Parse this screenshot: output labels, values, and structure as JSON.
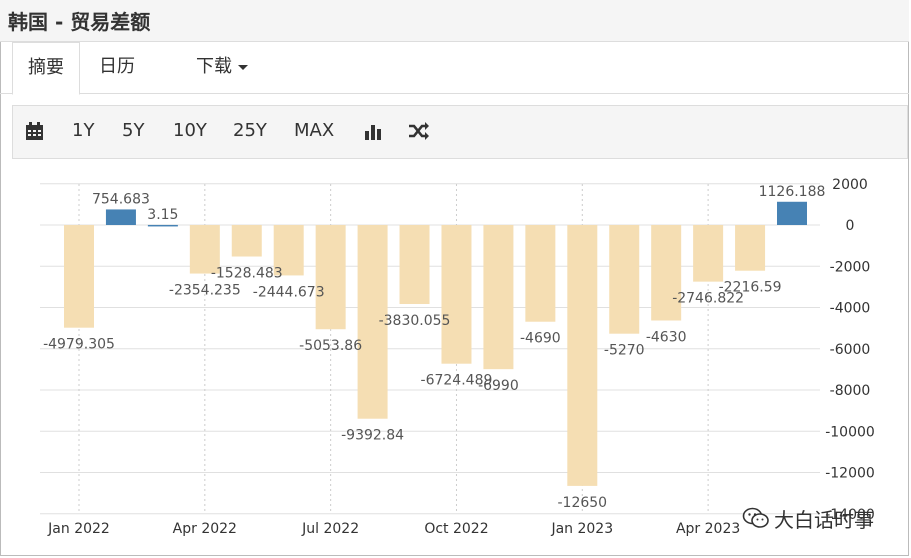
{
  "header": {
    "title": "韩国 - 贸易差额"
  },
  "tabs": [
    {
      "label": "摘要",
      "active": true
    },
    {
      "label": "日历",
      "active": false
    },
    {
      "label": "下载",
      "active": false
    }
  ],
  "toolbar": {
    "ranges": [
      "1Y",
      "5Y",
      "10Y",
      "25Y",
      "MAX"
    ],
    "icons": [
      "calendar-icon",
      "bar-chart-icon",
      "shuffle-icon"
    ]
  },
  "watermark": {
    "text": "大白话时事",
    "icon": "wechat-icon"
  },
  "colors": {
    "positive": "#4682b4",
    "negative": "#f5deb3",
    "grid": "#e0e0e0"
  },
  "chart_data": {
    "type": "bar",
    "categories": [
      "Jan 2022",
      "Feb 2022",
      "Mar 2022",
      "Apr 2022",
      "May 2022",
      "Jun 2022",
      "Jul 2022",
      "Aug 2022",
      "Sep 2022",
      "Oct 2022",
      "Nov 2022",
      "Dec 2022",
      "Jan 2023",
      "Feb 2023",
      "Mar 2023",
      "Apr 2023",
      "May 2023",
      "Jun 2023"
    ],
    "values": [
      -4979.305,
      754.683,
      3.15,
      -2354.235,
      -1528.483,
      -2444.673,
      -5053.86,
      -9392.84,
      -3830.055,
      -6724.489,
      -6990,
      -4690,
      -12650,
      -5270,
      -4630,
      -2746.822,
      -2216.59,
      1126.188
    ],
    "value_labels": [
      "-4979.305",
      "754.683",
      "3.15",
      "-2354.235",
      "-1528.483",
      "-2444.673",
      "-5053.86",
      "-9392.84",
      "-3830.055",
      "-6724.489",
      "-6990",
      "-4690",
      "-12650",
      "-5270",
      "-4630",
      "-2746.822",
      "-2216.59",
      "1126.188"
    ],
    "x_tick_labels": [
      "Jan 2022",
      "Apr 2022",
      "Jul 2022",
      "Oct 2022",
      "Jan 2023",
      "Apr 2023"
    ],
    "x_tick_categories": [
      "Jan 2022",
      "Apr 2022",
      "Jul 2022",
      "Oct 2022",
      "Jan 2023",
      "Apr 2023"
    ],
    "y_ticks": [
      2000,
      0,
      -2000,
      -4000,
      -6000,
      -8000,
      -10000,
      -12000,
      -14000
    ],
    "y_tick_labels": [
      "2000",
      "0",
      "-2000",
      "-4000",
      "-6000",
      "-8000",
      "-10000",
      "-12000",
      "-14000"
    ],
    "ylim": [
      -14000,
      2000
    ],
    "grid": true,
    "y_axis_position": "right"
  }
}
